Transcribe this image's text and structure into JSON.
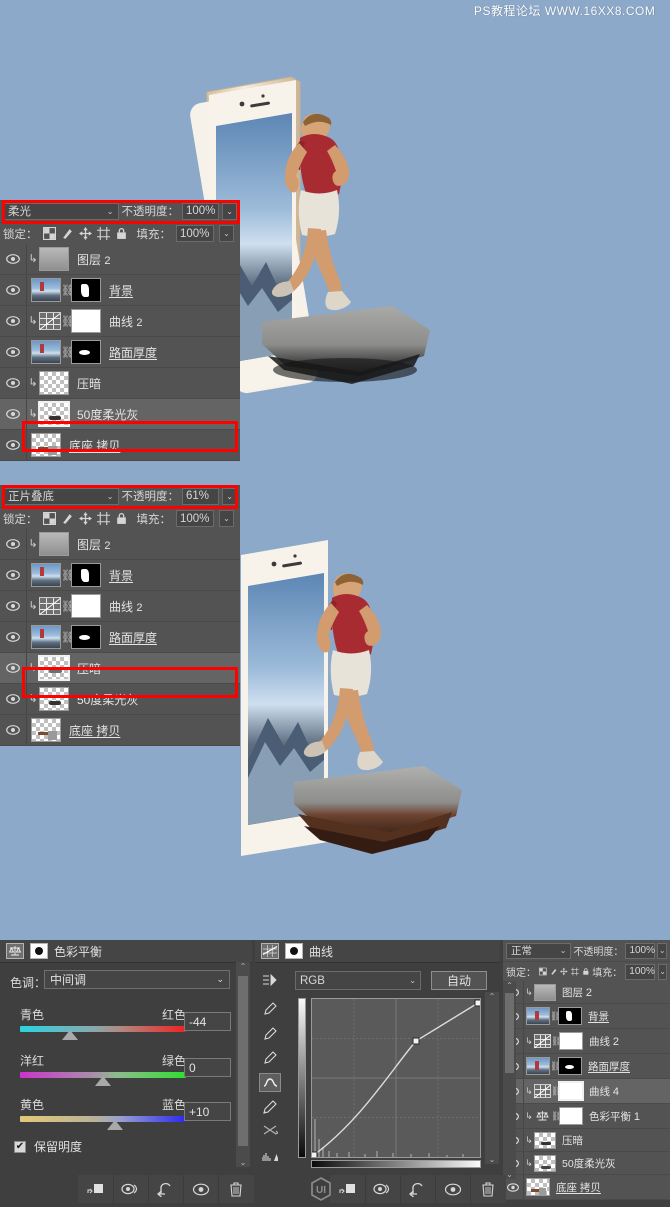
{
  "watermark": "PS教程论坛 WWW.16XX8.COM",
  "panel_top": {
    "blend_mode": "柔光",
    "opacity_label": "不透明度：",
    "opacity_value": "100%",
    "lock_label": "锁定：",
    "fill_label": "填充：",
    "fill_value": "100%",
    "layers": [
      {
        "name": "图层",
        "index": "2",
        "type": "pixel-clipped"
      },
      {
        "name": "背景",
        "index": "",
        "type": "photo-mask"
      },
      {
        "name": "曲线",
        "index": "2",
        "type": "curves-adjustment"
      },
      {
        "name": "路面厚度",
        "index": "",
        "type": "photo-mask"
      },
      {
        "name": "压暗",
        "index": "",
        "type": "pixel-clipped"
      },
      {
        "name": "50度柔光灰",
        "index": "",
        "type": "pixel-clipped",
        "selected": true
      },
      {
        "name": "底座 拷贝",
        "index": "",
        "type": "pixel"
      }
    ]
  },
  "panel_mid": {
    "blend_mode": "正片叠底",
    "opacity_label": "不透明度：",
    "opacity_value": "61%",
    "lock_label": "锁定：",
    "fill_label": "填充：",
    "fill_value": "100%",
    "layers": [
      {
        "name": "图层",
        "index": "2",
        "type": "pixel-clipped"
      },
      {
        "name": "背景",
        "index": "",
        "type": "photo-mask"
      },
      {
        "name": "曲线",
        "index": "2",
        "type": "curves-adjustment"
      },
      {
        "name": "路面厚度",
        "index": "",
        "type": "photo-mask"
      },
      {
        "name": "压暗",
        "index": "",
        "type": "pixel-clipped",
        "selected": true
      },
      {
        "name": "50度柔光灰",
        "index": "",
        "type": "pixel-clipped"
      },
      {
        "name": "底座 拷贝",
        "index": "",
        "type": "pixel"
      }
    ]
  },
  "color_balance": {
    "title": "色彩平衡",
    "tone_label": "色调：",
    "tone_value": "中间调",
    "sliders": [
      {
        "left": "青色",
        "right": "红色",
        "value": "-44",
        "knob_pct": 30
      },
      {
        "left": "洋红",
        "right": "绿色",
        "value": "0",
        "knob_pct": 50
      },
      {
        "left": "黄色",
        "right": "蓝色",
        "value": "+10",
        "knob_pct": 57
      }
    ],
    "preserve_label": "保留明度",
    "preserve_checked": true,
    "check_glyph": "✔"
  },
  "curves": {
    "title": "曲线",
    "channel": "RGB",
    "auto_label": "自动",
    "points": [
      [
        0,
        0
      ],
      [
        62,
        72
      ],
      [
        100,
        100
      ]
    ],
    "grid_divisions": 4
  },
  "panel_right": {
    "blend_mode": "正常",
    "opacity_label": "不透明度：",
    "opacity_value": "100%",
    "lock_label": "锁定：",
    "fill_label": "填充：",
    "fill_value": "100%",
    "layers": [
      {
        "name": "图层",
        "index": "2",
        "type": "pixel-clipped"
      },
      {
        "name": "背景",
        "index": "",
        "type": "photo-mask"
      },
      {
        "name": "曲线",
        "index": "2",
        "type": "curves-adjustment"
      },
      {
        "name": "路面厚度",
        "index": "",
        "type": "photo-mask"
      },
      {
        "name": "曲线",
        "index": "4",
        "type": "curves-adjustment-white",
        "selected": true
      },
      {
        "name": "色彩平衡",
        "index": "1",
        "type": "balance-adjustment"
      },
      {
        "name": "压暗",
        "index": "",
        "type": "pixel-clipped"
      },
      {
        "name": "50度柔光灰",
        "index": "",
        "type": "pixel-clipped"
      },
      {
        "name": "底座 拷贝",
        "index": "",
        "type": "pixel"
      }
    ]
  },
  "footer_icons": [
    "link-layers-icon",
    "fx-icon",
    "new-adjustment-icon",
    "layer-mask-icon",
    "delete-layer-icon"
  ],
  "icons": {
    "eye": "◉",
    "clip_arrow": "⌐",
    "chevron": "⌄",
    "link": "⛓",
    "lock_transparent": "▨",
    "lock_brush": "✎",
    "lock_move": "✥",
    "lock_artboard": "⊞",
    "lock_all": "🔒",
    "trash": "🗑",
    "eyedropper": "✎",
    "curve_pen": "∿",
    "pencil": "✏",
    "smooth": "≈",
    "histogram": "▦"
  },
  "colors": {
    "background": "#8ca9ca",
    "panel": "#535353",
    "panel_selected": "#646464",
    "highlight_box": "#ff0000",
    "accent_red_shirt": "#a82b32"
  }
}
